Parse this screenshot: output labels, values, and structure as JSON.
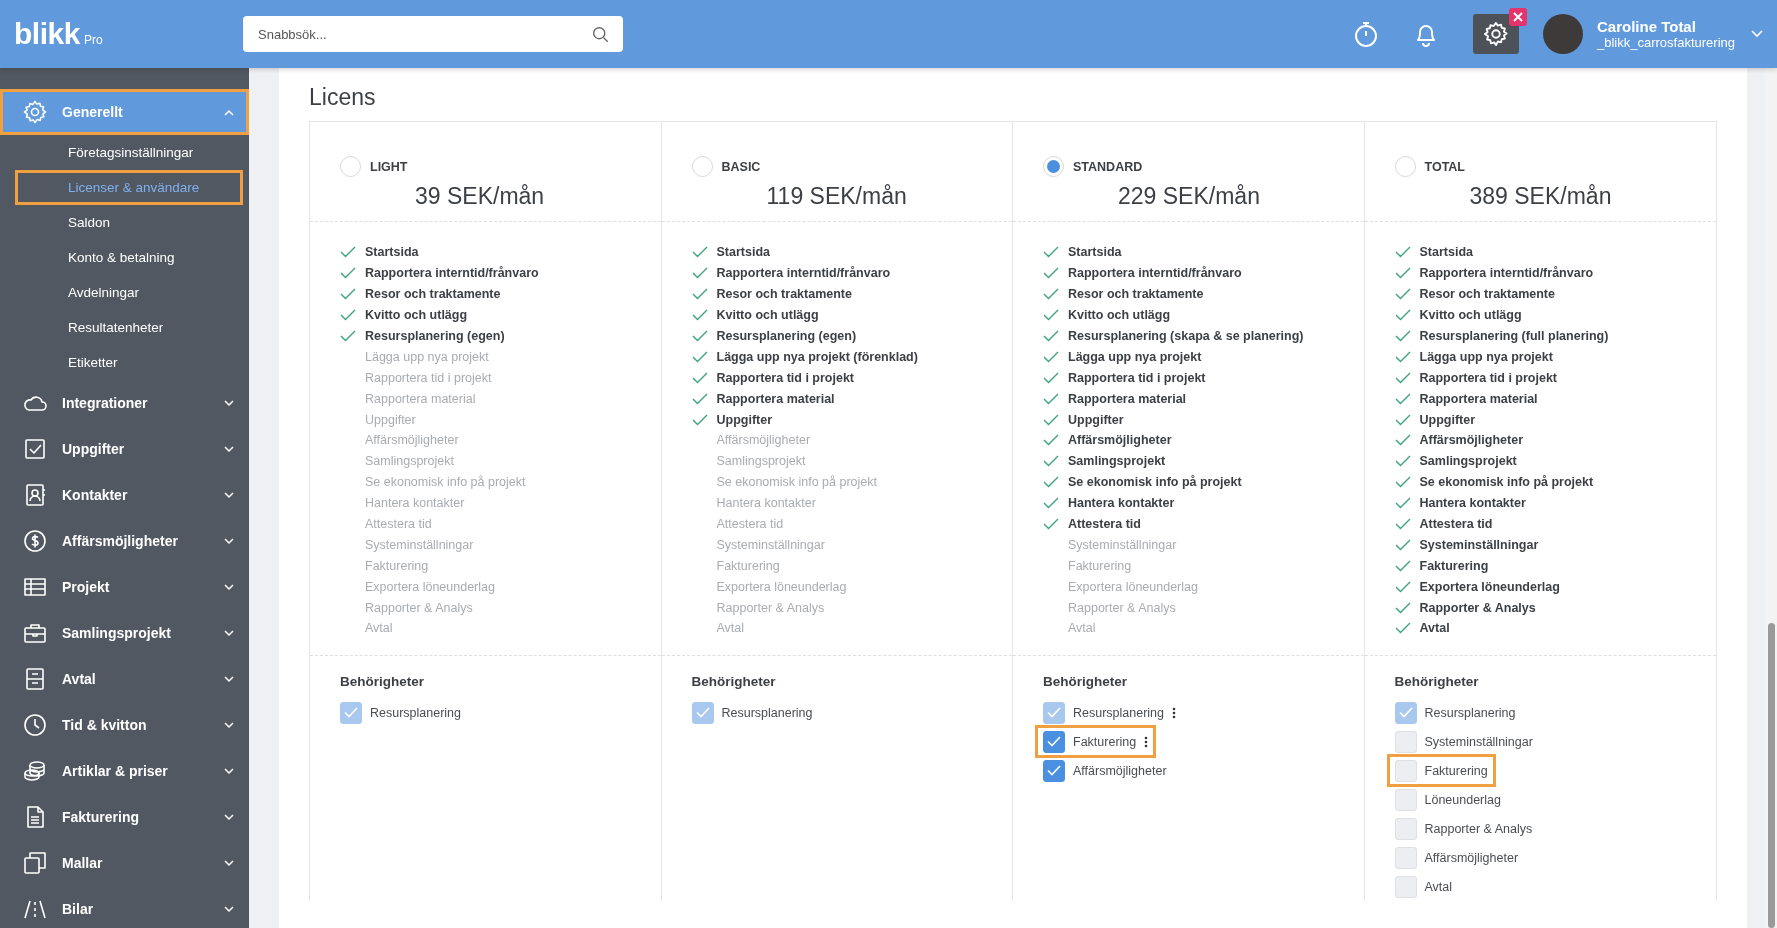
{
  "header": {
    "logo": "blikk",
    "logo_suffix": "Pro",
    "search": {
      "placeholder": "Snabbsök..."
    },
    "user": {
      "name": "Caroline Total",
      "username": "_blikk_carrosfakturering"
    }
  },
  "sidebar": {
    "items": [
      {
        "label": "Generellt",
        "selected": true,
        "expanded": true,
        "highlighted": true,
        "children": [
          {
            "label": "Företagsinställningar",
            "selected": false,
            "highlighted": false
          },
          {
            "label": "Licenser & användare",
            "selected": true,
            "highlighted": true
          },
          {
            "label": "Saldon",
            "selected": false,
            "highlighted": false
          },
          {
            "label": "Konto & betalning",
            "selected": false,
            "highlighted": false
          },
          {
            "label": "Avdelningar",
            "selected": false,
            "highlighted": false
          },
          {
            "label": "Resultatenheter",
            "selected": false,
            "highlighted": false
          },
          {
            "label": "Etiketter",
            "selected": false,
            "highlighted": false
          }
        ]
      },
      {
        "label": "Integrationer",
        "selected": false,
        "expanded": false,
        "highlighted": false
      },
      {
        "label": "Uppgifter",
        "selected": false,
        "expanded": false,
        "highlighted": false
      },
      {
        "label": "Kontakter",
        "selected": false,
        "expanded": false,
        "highlighted": false
      },
      {
        "label": "Affärsmöjligheter",
        "selected": false,
        "expanded": false,
        "highlighted": false
      },
      {
        "label": "Projekt",
        "selected": false,
        "expanded": false,
        "highlighted": false
      },
      {
        "label": "Samlingsprojekt",
        "selected": false,
        "expanded": false,
        "highlighted": false
      },
      {
        "label": "Avtal",
        "selected": false,
        "expanded": false,
        "highlighted": false
      },
      {
        "label": "Tid & kvitton",
        "selected": false,
        "expanded": false,
        "highlighted": false
      },
      {
        "label": "Artiklar & priser",
        "selected": false,
        "expanded": false,
        "highlighted": false
      },
      {
        "label": "Fakturering",
        "selected": false,
        "expanded": false,
        "highlighted": false
      },
      {
        "label": "Mallar",
        "selected": false,
        "expanded": false,
        "highlighted": false
      },
      {
        "label": "Bilar",
        "selected": false,
        "expanded": false,
        "highlighted": false
      }
    ]
  },
  "page": {
    "title": "Licens",
    "plans": [
      {
        "name": "LIGHT",
        "price": "39 SEK/mån",
        "selected": false,
        "features": [
          {
            "label": "Startsida",
            "included": true
          },
          {
            "label": "Rapportera interntid/frånvaro",
            "included": true
          },
          {
            "label": "Resor och traktamente",
            "included": true
          },
          {
            "label": "Kvitto och utlägg",
            "included": true
          },
          {
            "label": "Resursplanering (egen)",
            "included": true
          },
          {
            "label": "Lägga upp nya projekt",
            "included": false
          },
          {
            "label": "Rapportera tid i projekt",
            "included": false
          },
          {
            "label": "Rapportera material",
            "included": false
          },
          {
            "label": "Uppgifter",
            "included": false
          },
          {
            "label": "Affärsmöjligheter",
            "included": false
          },
          {
            "label": "Samlingsprojekt",
            "included": false
          },
          {
            "label": "Se ekonomisk info på projekt",
            "included": false
          },
          {
            "label": "Hantera kontakter",
            "included": false
          },
          {
            "label": "Attestera tid",
            "included": false
          },
          {
            "label": "Systeminställningar",
            "included": false
          },
          {
            "label": "Fakturering",
            "included": false
          },
          {
            "label": "Exportera löneunderlag",
            "included": false
          },
          {
            "label": "Rapporter & Analys",
            "included": false
          },
          {
            "label": "Avtal",
            "included": false
          }
        ],
        "permissions_title": "Behörigheter",
        "permissions": [
          {
            "label": "Resursplanering",
            "checked": true,
            "disabled": true,
            "has_menu": false,
            "highlighted": false
          }
        ]
      },
      {
        "name": "BASIC",
        "price": "119 SEK/mån",
        "selected": false,
        "features": [
          {
            "label": "Startsida",
            "included": true
          },
          {
            "label": "Rapportera interntid/frånvaro",
            "included": true
          },
          {
            "label": "Resor och traktamente",
            "included": true
          },
          {
            "label": "Kvitto och utlägg",
            "included": true
          },
          {
            "label": "Resursplanering (egen)",
            "included": true
          },
          {
            "label": "Lägga upp nya projekt (förenklad)",
            "included": true
          },
          {
            "label": "Rapportera tid i projekt",
            "included": true
          },
          {
            "label": "Rapportera material",
            "included": true
          },
          {
            "label": "Uppgifter",
            "included": true
          },
          {
            "label": "Affärsmöjligheter",
            "included": false
          },
          {
            "label": "Samlingsprojekt",
            "included": false
          },
          {
            "label": "Se ekonomisk info på projekt",
            "included": false
          },
          {
            "label": "Hantera kontakter",
            "included": false
          },
          {
            "label": "Attestera tid",
            "included": false
          },
          {
            "label": "Systeminställningar",
            "included": false
          },
          {
            "label": "Fakturering",
            "included": false
          },
          {
            "label": "Exportera löneunderlag",
            "included": false
          },
          {
            "label": "Rapporter & Analys",
            "included": false
          },
          {
            "label": "Avtal",
            "included": false
          }
        ],
        "permissions_title": "Behörigheter",
        "permissions": [
          {
            "label": "Resursplanering",
            "checked": true,
            "disabled": true,
            "has_menu": false,
            "highlighted": false
          }
        ]
      },
      {
        "name": "STANDARD",
        "price": "229 SEK/mån",
        "selected": true,
        "features": [
          {
            "label": "Startsida",
            "included": true
          },
          {
            "label": "Rapportera interntid/frånvaro",
            "included": true
          },
          {
            "label": "Resor och traktamente",
            "included": true
          },
          {
            "label": "Kvitto och utlägg",
            "included": true
          },
          {
            "label": "Resursplanering (skapa & se planering)",
            "included": true
          },
          {
            "label": "Lägga upp nya projekt",
            "included": true
          },
          {
            "label": "Rapportera tid i projekt",
            "included": true
          },
          {
            "label": "Rapportera material",
            "included": true
          },
          {
            "label": "Uppgifter",
            "included": true
          },
          {
            "label": "Affärsmöjligheter",
            "included": true
          },
          {
            "label": "Samlingsprojekt",
            "included": true
          },
          {
            "label": "Se ekonomisk info på projekt",
            "included": true
          },
          {
            "label": "Hantera kontakter",
            "included": true
          },
          {
            "label": "Attestera tid",
            "included": true
          },
          {
            "label": "Systeminställningar",
            "included": false
          },
          {
            "label": "Fakturering",
            "included": false
          },
          {
            "label": "Exportera löneunderlag",
            "included": false
          },
          {
            "label": "Rapporter & Analys",
            "included": false
          },
          {
            "label": "Avtal",
            "included": false
          }
        ],
        "permissions_title": "Behörigheter",
        "permissions": [
          {
            "label": "Resursplanering",
            "checked": true,
            "disabled": true,
            "has_menu": true,
            "highlighted": false
          },
          {
            "label": "Fakturering",
            "checked": true,
            "disabled": false,
            "has_menu": true,
            "highlighted": true
          },
          {
            "label": "Affärsmöjligheter",
            "checked": true,
            "disabled": false,
            "has_menu": false,
            "highlighted": false
          }
        ]
      },
      {
        "name": "TOTAL",
        "price": "389 SEK/mån",
        "selected": false,
        "features": [
          {
            "label": "Startsida",
            "included": true
          },
          {
            "label": "Rapportera interntid/frånvaro",
            "included": true
          },
          {
            "label": "Resor och traktamente",
            "included": true
          },
          {
            "label": "Kvitto och utlägg",
            "included": true
          },
          {
            "label": "Resursplanering (full planering)",
            "included": true
          },
          {
            "label": "Lägga upp nya projekt",
            "included": true
          },
          {
            "label": "Rapportera tid i projekt",
            "included": true
          },
          {
            "label": "Rapportera material",
            "included": true
          },
          {
            "label": "Uppgifter",
            "included": true
          },
          {
            "label": "Affärsmöjligheter",
            "included": true
          },
          {
            "label": "Samlingsprojekt",
            "included": true
          },
          {
            "label": "Se ekonomisk info på projekt",
            "included": true
          },
          {
            "label": "Hantera kontakter",
            "included": true
          },
          {
            "label": "Attestera tid",
            "included": true
          },
          {
            "label": "Systeminställningar",
            "included": true
          },
          {
            "label": "Fakturering",
            "included": true
          },
          {
            "label": "Exportera löneunderlag",
            "included": true
          },
          {
            "label": "Rapporter & Analys",
            "included": true
          },
          {
            "label": "Avtal",
            "included": true
          }
        ],
        "permissions_title": "Behörigheter",
        "permissions": [
          {
            "label": "Resursplanering",
            "checked": true,
            "disabled": true,
            "has_menu": false,
            "highlighted": false
          },
          {
            "label": "Systeminställningar",
            "checked": false,
            "disabled": false,
            "has_menu": false,
            "highlighted": false
          },
          {
            "label": "Fakturering",
            "checked": false,
            "disabled": false,
            "has_menu": false,
            "highlighted": true
          },
          {
            "label": "Löneunderlag",
            "checked": false,
            "disabled": false,
            "has_menu": false,
            "highlighted": false
          },
          {
            "label": "Rapporter & Analys",
            "checked": false,
            "disabled": false,
            "has_menu": false,
            "highlighted": false
          },
          {
            "label": "Affärsmöjligheter",
            "checked": false,
            "disabled": false,
            "has_menu": false,
            "highlighted": false
          },
          {
            "label": "Avtal",
            "checked": false,
            "disabled": false,
            "has_menu": false,
            "highlighted": false
          }
        ]
      }
    ]
  }
}
